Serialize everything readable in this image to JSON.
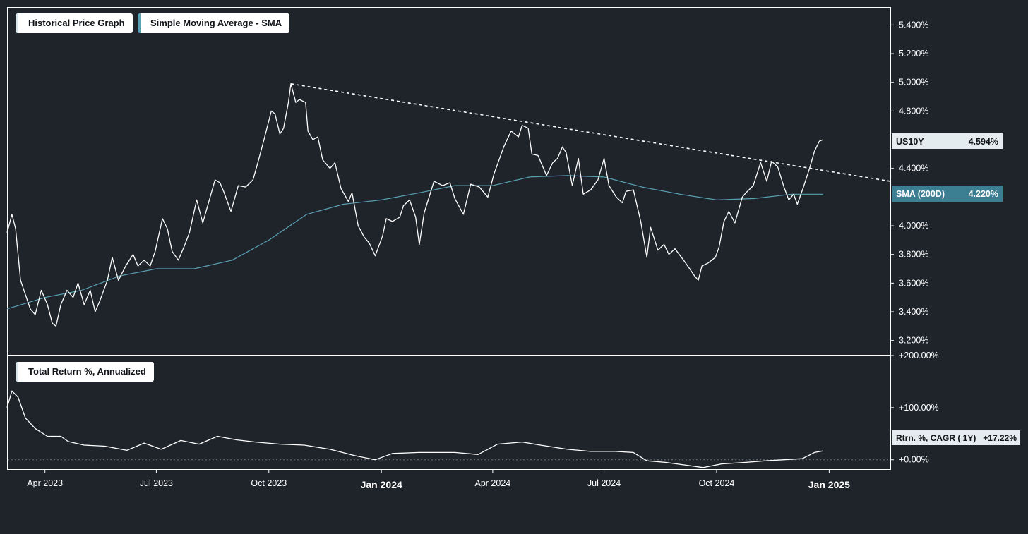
{
  "legends": {
    "price": "Historical Price Graph",
    "sma": "Simple Moving Average - SMA",
    "returns": "Total Return %, Annualized"
  },
  "badges": {
    "price": {
      "label": "US10Y",
      "value": "4.594%"
    },
    "sma": {
      "label": "SMA (200D)",
      "value": "4.220%"
    },
    "returns": {
      "label": "Rtrn. %, CAGR ( 1Y)",
      "value": "+17.22%"
    }
  },
  "colors": {
    "background": "#1f242b",
    "price_line": "#ffffff",
    "sma_line": "#5aa0b3",
    "sma_badge": "#3c7f93",
    "price_badge": "#e4ecef"
  },
  "chart_data": [
    {
      "type": "line",
      "name": "price-panel",
      "x_axis": {
        "labels": [
          {
            "date": "2023-04-01",
            "text": "Apr 2023",
            "major": false
          },
          {
            "date": "2023-07-01",
            "text": "Jul 2023",
            "major": false
          },
          {
            "date": "2023-10-01",
            "text": "Oct 2023",
            "major": false
          },
          {
            "date": "2024-01-01",
            "text": "Jan 2024",
            "major": true
          },
          {
            "date": "2024-04-01",
            "text": "Apr 2024",
            "major": false
          },
          {
            "date": "2024-07-01",
            "text": "Jul 2024",
            "major": false
          },
          {
            "date": "2024-10-01",
            "text": "Oct 2024",
            "major": false
          },
          {
            "date": "2025-01-01",
            "text": "Jan 2025",
            "major": true
          }
        ],
        "xlim": [
          "2023-03-01",
          "2025-02-20"
        ]
      },
      "y_ticks": [
        "5.400%",
        "5.200%",
        "5.000%",
        "4.800%",
        "4.400%",
        "4.000%",
        "3.800%",
        "3.600%",
        "3.400%",
        "3.200%"
      ],
      "y_tick_values": [
        5.4,
        5.2,
        5.0,
        4.8,
        4.4,
        4.0,
        3.8,
        3.6,
        3.4,
        3.2
      ],
      "ylim": [
        3.1,
        5.52
      ],
      "series": [
        {
          "name": "US10Y",
          "color": "#ffffff",
          "points": [
            [
              "2023-03-01",
              3.95
            ],
            [
              "2023-03-05",
              4.08
            ],
            [
              "2023-03-08",
              3.98
            ],
            [
              "2023-03-12",
              3.62
            ],
            [
              "2023-03-16",
              3.52
            ],
            [
              "2023-03-20",
              3.42
            ],
            [
              "2023-03-24",
              3.38
            ],
            [
              "2023-03-29",
              3.55
            ],
            [
              "2023-04-03",
              3.45
            ],
            [
              "2023-04-07",
              3.32
            ],
            [
              "2023-04-10",
              3.3
            ],
            [
              "2023-04-14",
              3.45
            ],
            [
              "2023-04-19",
              3.55
            ],
            [
              "2023-04-24",
              3.5
            ],
            [
              "2023-04-28",
              3.6
            ],
            [
              "2023-05-03",
              3.45
            ],
            [
              "2023-05-08",
              3.55
            ],
            [
              "2023-05-12",
              3.4
            ],
            [
              "2023-05-16",
              3.48
            ],
            [
              "2023-05-22",
              3.62
            ],
            [
              "2023-05-26",
              3.78
            ],
            [
              "2023-05-31",
              3.62
            ],
            [
              "2023-06-06",
              3.72
            ],
            [
              "2023-06-12",
              3.8
            ],
            [
              "2023-06-16",
              3.72
            ],
            [
              "2023-06-21",
              3.76
            ],
            [
              "2023-06-26",
              3.72
            ],
            [
              "2023-06-30",
              3.82
            ],
            [
              "2023-07-06",
              4.05
            ],
            [
              "2023-07-10",
              3.98
            ],
            [
              "2023-07-14",
              3.82
            ],
            [
              "2023-07-19",
              3.76
            ],
            [
              "2023-07-24",
              3.86
            ],
            [
              "2023-07-28",
              3.95
            ],
            [
              "2023-08-03",
              4.18
            ],
            [
              "2023-08-08",
              4.02
            ],
            [
              "2023-08-14",
              4.2
            ],
            [
              "2023-08-18",
              4.32
            ],
            [
              "2023-08-22",
              4.3
            ],
            [
              "2023-08-25",
              4.24
            ],
            [
              "2023-08-31",
              4.1
            ],
            [
              "2023-09-06",
              4.28
            ],
            [
              "2023-09-12",
              4.27
            ],
            [
              "2023-09-18",
              4.32
            ],
            [
              "2023-09-22",
              4.44
            ],
            [
              "2023-09-27",
              4.6
            ],
            [
              "2023-10-03",
              4.8
            ],
            [
              "2023-10-06",
              4.78
            ],
            [
              "2023-10-10",
              4.64
            ],
            [
              "2023-10-13",
              4.68
            ],
            [
              "2023-10-17",
              4.86
            ],
            [
              "2023-10-19",
              4.99
            ],
            [
              "2023-10-23",
              4.86
            ],
            [
              "2023-10-26",
              4.88
            ],
            [
              "2023-10-31",
              4.86
            ],
            [
              "2023-11-02",
              4.66
            ],
            [
              "2023-11-06",
              4.6
            ],
            [
              "2023-11-10",
              4.62
            ],
            [
              "2023-11-14",
              4.46
            ],
            [
              "2023-11-20",
              4.4
            ],
            [
              "2023-11-24",
              4.44
            ],
            [
              "2023-11-29",
              4.26
            ],
            [
              "2023-12-05",
              4.17
            ],
            [
              "2023-12-08",
              4.23
            ],
            [
              "2023-12-13",
              4.0
            ],
            [
              "2023-12-18",
              3.92
            ],
            [
              "2023-12-22",
              3.88
            ],
            [
              "2023-12-27",
              3.79
            ],
            [
              "2024-01-02",
              3.93
            ],
            [
              "2024-01-05",
              4.05
            ],
            [
              "2024-01-10",
              4.03
            ],
            [
              "2024-01-16",
              4.06
            ],
            [
              "2024-01-19",
              4.14
            ],
            [
              "2024-01-24",
              4.18
            ],
            [
              "2024-01-29",
              4.06
            ],
            [
              "2024-02-01",
              3.87
            ],
            [
              "2024-02-05",
              4.09
            ],
            [
              "2024-02-13",
              4.31
            ],
            [
              "2024-02-20",
              4.28
            ],
            [
              "2024-02-26",
              4.3
            ],
            [
              "2024-03-01",
              4.19
            ],
            [
              "2024-03-08",
              4.08
            ],
            [
              "2024-03-14",
              4.29
            ],
            [
              "2024-03-21",
              4.27
            ],
            [
              "2024-03-28",
              4.2
            ],
            [
              "2024-04-02",
              4.36
            ],
            [
              "2024-04-10",
              4.55
            ],
            [
              "2024-04-16",
              4.66
            ],
            [
              "2024-04-22",
              4.62
            ],
            [
              "2024-04-25",
              4.7
            ],
            [
              "2024-04-30",
              4.68
            ],
            [
              "2024-05-03",
              4.5
            ],
            [
              "2024-05-08",
              4.49
            ],
            [
              "2024-05-15",
              4.35
            ],
            [
              "2024-05-20",
              4.44
            ],
            [
              "2024-05-24",
              4.47
            ],
            [
              "2024-05-28",
              4.55
            ],
            [
              "2024-05-31",
              4.51
            ],
            [
              "2024-06-05",
              4.28
            ],
            [
              "2024-06-10",
              4.47
            ],
            [
              "2024-06-14",
              4.22
            ],
            [
              "2024-06-20",
              4.25
            ],
            [
              "2024-06-26",
              4.32
            ],
            [
              "2024-07-01",
              4.47
            ],
            [
              "2024-07-05",
              4.28
            ],
            [
              "2024-07-11",
              4.2
            ],
            [
              "2024-07-16",
              4.16
            ],
            [
              "2024-07-19",
              4.24
            ],
            [
              "2024-07-25",
              4.25
            ],
            [
              "2024-07-31",
              4.03
            ],
            [
              "2024-08-05",
              3.78
            ],
            [
              "2024-08-08",
              3.99
            ],
            [
              "2024-08-14",
              3.83
            ],
            [
              "2024-08-19",
              3.87
            ],
            [
              "2024-08-23",
              3.8
            ],
            [
              "2024-08-28",
              3.84
            ],
            [
              "2024-09-04",
              3.76
            ],
            [
              "2024-09-09",
              3.7
            ],
            [
              "2024-09-13",
              3.65
            ],
            [
              "2024-09-16",
              3.62
            ],
            [
              "2024-09-19",
              3.72
            ],
            [
              "2024-09-24",
              3.74
            ],
            [
              "2024-09-30",
              3.78
            ],
            [
              "2024-10-03",
              3.85
            ],
            [
              "2024-10-07",
              4.03
            ],
            [
              "2024-10-11",
              4.1
            ],
            [
              "2024-10-16",
              4.02
            ],
            [
              "2024-10-22",
              4.2
            ],
            [
              "2024-10-25",
              4.23
            ],
            [
              "2024-10-31",
              4.28
            ],
            [
              "2024-11-06",
              4.44
            ],
            [
              "2024-11-11",
              4.31
            ],
            [
              "2024-11-15",
              4.45
            ],
            [
              "2024-11-20",
              4.41
            ],
            [
              "2024-11-25",
              4.27
            ],
            [
              "2024-11-29",
              4.18
            ],
            [
              "2024-12-03",
              4.22
            ],
            [
              "2024-12-06",
              4.15
            ],
            [
              "2024-12-11",
              4.27
            ],
            [
              "2024-12-16",
              4.4
            ],
            [
              "2024-12-20",
              4.52
            ],
            [
              "2024-12-24",
              4.59
            ],
            [
              "2024-12-27",
              4.6
            ]
          ]
        },
        {
          "name": "SMA (200D)",
          "color": "#5aa0b3",
          "points": [
            [
              "2023-03-01",
              3.42
            ],
            [
              "2023-04-01",
              3.5
            ],
            [
              "2023-05-01",
              3.55
            ],
            [
              "2023-06-01",
              3.65
            ],
            [
              "2023-07-01",
              3.7
            ],
            [
              "2023-08-01",
              3.7
            ],
            [
              "2023-09-01",
              3.76
            ],
            [
              "2023-10-01",
              3.9
            ],
            [
              "2023-11-01",
              4.08
            ],
            [
              "2023-12-01",
              4.15
            ],
            [
              "2024-01-01",
              4.18
            ],
            [
              "2024-02-01",
              4.23
            ],
            [
              "2024-03-01",
              4.28
            ],
            [
              "2024-04-01",
              4.28
            ],
            [
              "2024-05-01",
              4.34
            ],
            [
              "2024-06-01",
              4.35
            ],
            [
              "2024-07-01",
              4.34
            ],
            [
              "2024-08-01",
              4.27
            ],
            [
              "2024-09-01",
              4.22
            ],
            [
              "2024-10-01",
              4.18
            ],
            [
              "2024-11-01",
              4.19
            ],
            [
              "2024-12-01",
              4.22
            ],
            [
              "2024-12-27",
              4.22
            ]
          ]
        },
        {
          "name": "trendline",
          "color": "#ffffff",
          "dashed": true,
          "points": [
            [
              "2023-10-19",
              4.99
            ],
            [
              "2025-02-20",
              4.31
            ]
          ]
        }
      ]
    },
    {
      "type": "line",
      "name": "return-panel",
      "y_ticks": [
        "+200.00%",
        "+100.00%",
        "+0.00%"
      ],
      "y_tick_values": [
        200,
        100,
        0
      ],
      "ylim": [
        -18,
        200
      ],
      "series": [
        {
          "name": "Total Return %, Annualized",
          "color": "#ffffff",
          "points": [
            [
              "2023-03-01",
              100
            ],
            [
              "2023-03-05",
              132
            ],
            [
              "2023-03-10",
              120
            ],
            [
              "2023-03-16",
              80
            ],
            [
              "2023-03-24",
              60
            ],
            [
              "2023-04-03",
              45
            ],
            [
              "2023-04-14",
              45
            ],
            [
              "2023-04-20",
              35
            ],
            [
              "2023-05-03",
              28
            ],
            [
              "2023-05-20",
              26
            ],
            [
              "2023-06-07",
              18
            ],
            [
              "2023-06-21",
              32
            ],
            [
              "2023-07-05",
              20
            ],
            [
              "2023-07-21",
              37
            ],
            [
              "2023-08-05",
              30
            ],
            [
              "2023-08-20",
              45
            ],
            [
              "2023-09-05",
              38
            ],
            [
              "2023-09-20",
              34
            ],
            [
              "2023-10-10",
              30
            ],
            [
              "2023-10-30",
              28
            ],
            [
              "2023-11-20",
              20
            ],
            [
              "2023-12-10",
              8
            ],
            [
              "2023-12-27",
              0
            ],
            [
              "2024-01-10",
              12
            ],
            [
              "2024-02-01",
              14
            ],
            [
              "2024-03-01",
              14
            ],
            [
              "2024-03-20",
              10
            ],
            [
              "2024-04-05",
              30
            ],
            [
              "2024-04-25",
              34
            ],
            [
              "2024-05-10",
              28
            ],
            [
              "2024-06-01",
              20
            ],
            [
              "2024-06-20",
              16
            ],
            [
              "2024-07-10",
              16
            ],
            [
              "2024-07-25",
              14
            ],
            [
              "2024-08-05",
              -2
            ],
            [
              "2024-08-20",
              -5
            ],
            [
              "2024-09-05",
              -10
            ],
            [
              "2024-09-20",
              -15
            ],
            [
              "2024-10-05",
              -8
            ],
            [
              "2024-10-25",
              -5
            ],
            [
              "2024-11-10",
              -2
            ],
            [
              "2024-11-25",
              0
            ],
            [
              "2024-12-10",
              2
            ],
            [
              "2024-12-20",
              14
            ],
            [
              "2024-12-27",
              17
            ]
          ]
        }
      ]
    }
  ]
}
